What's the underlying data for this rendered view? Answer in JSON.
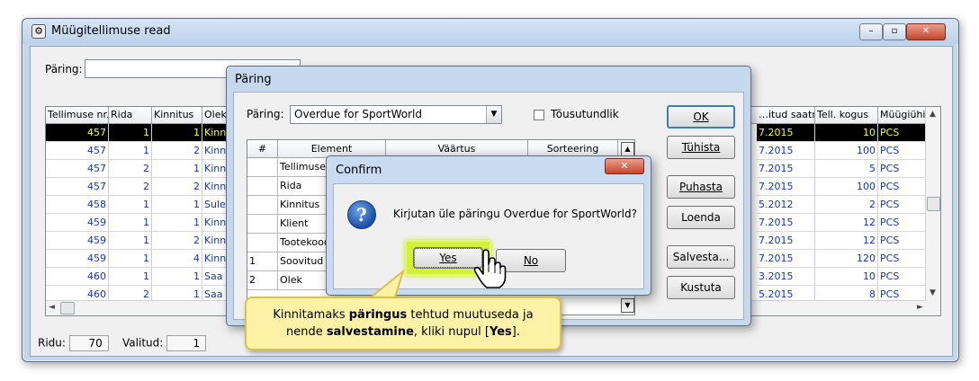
{
  "window": {
    "title": "Müügitellimuse read",
    "buttons": {
      "min": "–",
      "max": "▫",
      "close": "✕"
    }
  },
  "query": {
    "label": "Päring:",
    "value": ""
  },
  "grid": {
    "columns": [
      "Tellimuse nr.",
      "Rida",
      "Kinnitus",
      "Olek",
      "…itud saatn",
      "Tell. kogus",
      "Müügiühik"
    ],
    "rows": [
      {
        "order": "457",
        "line": "1",
        "confirm": "1",
        "status": "Kinn",
        "date": "7.2015",
        "qty": "10",
        "unit": "PCS",
        "selected": true
      },
      {
        "order": "457",
        "line": "1",
        "confirm": "2",
        "status": "Kinn",
        "date": "7.2015",
        "qty": "100",
        "unit": "PCS"
      },
      {
        "order": "457",
        "line": "2",
        "confirm": "1",
        "status": "Kinn",
        "date": "7.2015",
        "qty": "5",
        "unit": "PCS"
      },
      {
        "order": "457",
        "line": "2",
        "confirm": "2",
        "status": "Kinn",
        "date": "7.2015",
        "qty": "100",
        "unit": "PCS"
      },
      {
        "order": "458",
        "line": "1",
        "confirm": "1",
        "status": "Sule",
        "date": "5.2012",
        "qty": "2",
        "unit": "PCS"
      },
      {
        "order": "459",
        "line": "1",
        "confirm": "1",
        "status": "Kinn",
        "date": "7.2015",
        "qty": "12",
        "unit": "PCS"
      },
      {
        "order": "459",
        "line": "1",
        "confirm": "2",
        "status": "Kinn",
        "date": "7.2015",
        "qty": "12",
        "unit": "PCS"
      },
      {
        "order": "459",
        "line": "1",
        "confirm": "4",
        "status": "Kinn",
        "date": "7.2015",
        "qty": "120",
        "unit": "PCS"
      },
      {
        "order": "460",
        "line": "1",
        "confirm": "1",
        "status": "Saa",
        "date": "3.2015",
        "qty": "10",
        "unit": "PCS"
      },
      {
        "order": "460",
        "line": "2",
        "confirm": "1",
        "status": "Saa",
        "date": "5.2015",
        "qty": "8",
        "unit": "PCS"
      }
    ]
  },
  "status": {
    "rows_label": "Ridu:",
    "rows_value": "70",
    "selected_label": "Valitud:",
    "selected_value": "1"
  },
  "query_dialog": {
    "title": "Päring",
    "query_label": "Päring:",
    "query_value": "Overdue for SportWorld",
    "ascending_label": "Tõusutundlik",
    "columns": [
      "#",
      "Element",
      "Väärtus",
      "Sorteering"
    ],
    "rows": [
      {
        "num": "",
        "element": "Tellimuse nr"
      },
      {
        "num": "",
        "element": "Rida"
      },
      {
        "num": "",
        "element": "Kinnitus"
      },
      {
        "num": "",
        "element": "Klient"
      },
      {
        "num": "",
        "element": "Tootekood"
      },
      {
        "num": "1",
        "element": "Soovitud s"
      },
      {
        "num": "2",
        "element": "Olek"
      }
    ],
    "buttons": {
      "ok": "OK",
      "cancel": "Tühista",
      "clear": "Puhasta",
      "load": "Loenda",
      "save": "Salvesta...",
      "delete": "Kustuta"
    }
  },
  "confirm_dialog": {
    "title": "Confirm",
    "close": "✕",
    "message": "Kirjutan üle päringu Overdue for SportWorld?",
    "yes": "Yes",
    "no": "No"
  },
  "callout": {
    "part1": "Kinnitamaks ",
    "bold1": "päringus",
    "part2": " tehtud muutuseda ja",
    "part3": "nende ",
    "bold2": "salvestamine",
    "part4": ", kliki nupul [",
    "bold3": "Yes",
    "part5": "]."
  }
}
